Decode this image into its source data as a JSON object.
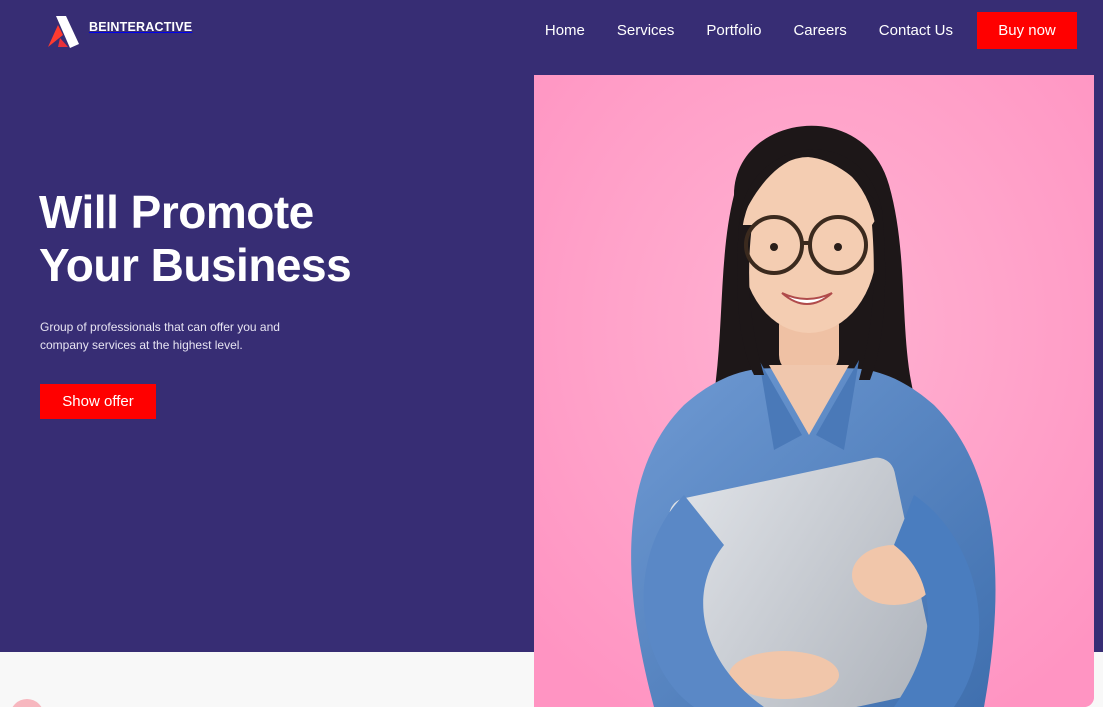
{
  "brand": {
    "name": "BEINTERACTIVE",
    "logo_icon": "stylized-a-logo-icon"
  },
  "nav": {
    "links": [
      "Home",
      "Services",
      "Portfolio",
      "Careers",
      "Contact Us"
    ],
    "cta_label": "Buy now"
  },
  "hero": {
    "title_line1": "Will Promote",
    "title_line2": "Your Business",
    "subtitle_line1": "Group of professionals that can offer you and",
    "subtitle_line2": "company services at the highest level.",
    "cta_label": "Show offer",
    "image": "smiling-woman-with-glasses-holding-laptop-photo"
  },
  "colors": {
    "hero_background": "#372d74",
    "accent": "#ff0000",
    "photo_background": "#ff9cc6",
    "page_background": "#f8f8f8"
  }
}
